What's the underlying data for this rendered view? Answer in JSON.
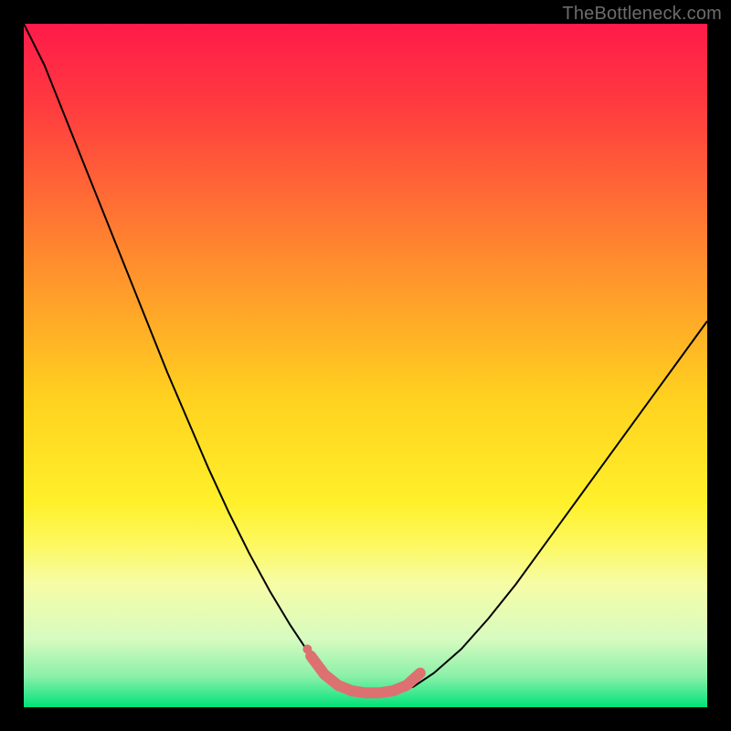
{
  "watermark": "TheBottleneck.com",
  "chart_data": {
    "type": "line",
    "title": "",
    "xlabel": "",
    "ylabel": "",
    "xlim": [
      0,
      100
    ],
    "ylim": [
      0,
      100
    ],
    "grid": false,
    "legend": false,
    "background_gradient": {
      "top_color": "#ff1a4a",
      "mid_color": "#ffe635",
      "bottom_color": "#00e27a",
      "bottom_band_start_pct": 76
    },
    "series": [
      {
        "name": "bottleneck-curve",
        "type": "line",
        "color": "#000000",
        "width": 2,
        "x": [
          0,
          3,
          6,
          9,
          12,
          15,
          18,
          21,
          24,
          27,
          30,
          33,
          36,
          39,
          41,
          43,
          45,
          47,
          49,
          51,
          54,
          57,
          60,
          64,
          68,
          72,
          76,
          80,
          84,
          88,
          92,
          96,
          100
        ],
        "y": [
          100,
          94,
          86.5,
          79,
          71.5,
          64,
          56.5,
          49,
          42,
          35,
          28.5,
          22.5,
          17,
          12,
          9,
          6.5,
          4.5,
          3,
          2.2,
          2,
          2.2,
          3,
          5,
          8.5,
          13,
          18,
          23.5,
          29,
          34.5,
          40,
          45.5,
          51,
          56.5
        ]
      },
      {
        "name": "optimal-zone-marker",
        "type": "line",
        "color": "#dd7171",
        "width": 12,
        "linecap": "round",
        "x": [
          42,
          44,
          46,
          48,
          50,
          52,
          54,
          56,
          58
        ],
        "y": [
          7.5,
          4.8,
          3.2,
          2.4,
          2.1,
          2.1,
          2.4,
          3.2,
          5.0
        ]
      },
      {
        "name": "optimal-zone-dot",
        "type": "scatter",
        "color": "#dd7171",
        "radius": 5,
        "x": [
          41.5
        ],
        "y": [
          8.5
        ]
      }
    ]
  }
}
